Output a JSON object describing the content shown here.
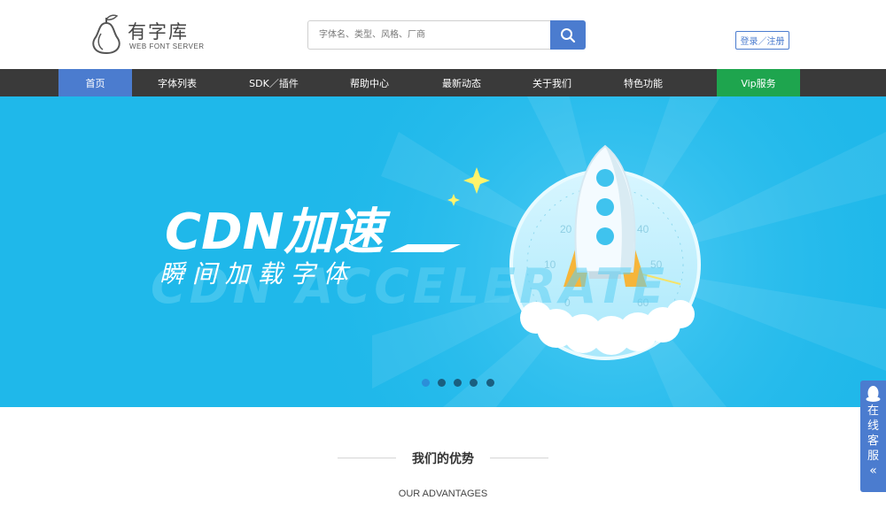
{
  "logo": {
    "name": "有字库",
    "sub": "WEB FONT SERVER"
  },
  "search": {
    "placeholder": "字体名、类型、风格、厂商",
    "value": ""
  },
  "header": {
    "login_label": "登录／注册"
  },
  "nav": {
    "items": [
      {
        "label": "首页",
        "active": true
      },
      {
        "label": "字体列表"
      },
      {
        "label": "SDK／插件"
      },
      {
        "label": "帮助中心"
      },
      {
        "label": "最新动态"
      },
      {
        "label": "关于我们"
      },
      {
        "label": "特色功能"
      },
      {
        "label": "Vip服务"
      }
    ]
  },
  "banner": {
    "headline": "CDN加速",
    "subtitle": "瞬 间 加 载 字 体",
    "shadow_text": "CDN ACCELERATE",
    "gauge_labels": [
      "0",
      "10",
      "20",
      "40",
      "50",
      "60"
    ],
    "slide_count": 5,
    "active_slide": 1
  },
  "advantages": {
    "title": "我们的优势",
    "subtitle": "OUR ADVANTAGES"
  },
  "service": {
    "label": "在线客服",
    "collapse": "«"
  },
  "colors": {
    "accent": "#4b7ccf",
    "nav_bg": "#3a3a3a",
    "vip": "#1ea54e",
    "banner": "#1fb8ea"
  }
}
